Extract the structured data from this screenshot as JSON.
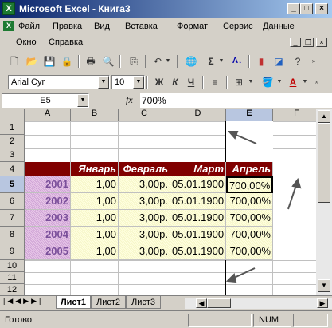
{
  "window": {
    "title": "Microsoft Excel - Книга3",
    "app_icon": "X",
    "minimize": "_",
    "maximize": "□",
    "close": "×"
  },
  "menus": {
    "row1": [
      "Файл",
      "Правка",
      "Вид",
      "Вставка",
      "Формат",
      "Сервис",
      "Данные"
    ],
    "row2": [
      "Окно",
      "Справка"
    ]
  },
  "toolbar": {
    "font_name": "Arial Cyr",
    "font_size": "10",
    "bold": "Ж",
    "italic": "К",
    "underline": "Ч",
    "sigma": "Σ"
  },
  "formula_bar": {
    "name_box": "E5",
    "fx": "fx",
    "value": "700%"
  },
  "sheet": {
    "columns": [
      "A",
      "B",
      "C",
      "D",
      "E",
      "F"
    ],
    "rows": [
      "1",
      "2",
      "3",
      "4",
      "5",
      "6",
      "7",
      "8",
      "9",
      "10",
      "11",
      "12"
    ],
    "header_row": {
      "b": "Январь",
      "c": "Февраль",
      "d": "Март",
      "e": "Апрель"
    },
    "data": [
      {
        "year": "2001",
        "b": "1,00",
        "c": "3,00р.",
        "d": "05.01.1900",
        "e": "700,00%"
      },
      {
        "year": "2002",
        "b": "1,00",
        "c": "3,00р.",
        "d": "05.01.1900",
        "e": "700,00%"
      },
      {
        "year": "2003",
        "b": "1,00",
        "c": "3,00р.",
        "d": "05.01.1900",
        "e": "700,00%"
      },
      {
        "year": "2004",
        "b": "1,00",
        "c": "3,00р.",
        "d": "05.01.1900",
        "e": "700,00%"
      },
      {
        "year": "2005",
        "b": "1,00",
        "c": "3,00р.",
        "d": "05.01.1900",
        "e": "700,00%"
      }
    ]
  },
  "tabs": [
    "Лист1",
    "Лист2",
    "Лист3"
  ],
  "status": {
    "left": "Готово",
    "num": "NUM"
  },
  "colors": {
    "header_bg": "#800000",
    "year_text": "#7a4f9a",
    "title_bar": "#0a246a"
  }
}
